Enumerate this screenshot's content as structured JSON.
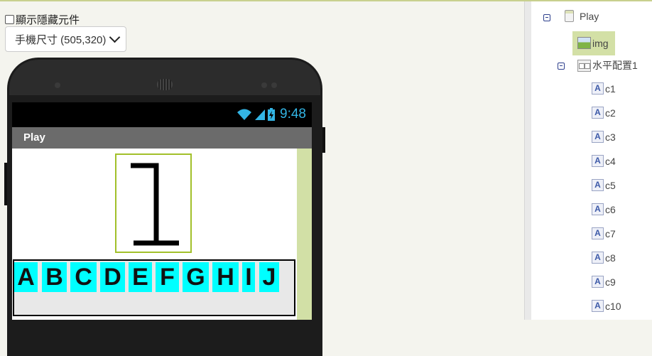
{
  "viewer": {
    "show_hidden_label": "顯示隱藏元件",
    "screen_size_select": "手機尺寸 (505,320)"
  },
  "phone": {
    "status_time": "9:48",
    "app_title": "Play",
    "image_digit": "1",
    "letters": [
      "A",
      "B",
      "C",
      "D",
      "E",
      "F",
      "G",
      "H",
      "I",
      "J"
    ],
    "letter_bg_color": "#00ffff"
  },
  "tree": {
    "root": "Play",
    "img": "img",
    "arrangement": "水平配置1",
    "labels": [
      "c1",
      "c2",
      "c3",
      "c4",
      "c5",
      "c6",
      "c7",
      "c8",
      "c9",
      "c10"
    ],
    "selected_highlight_color": "#d3e0a6"
  }
}
